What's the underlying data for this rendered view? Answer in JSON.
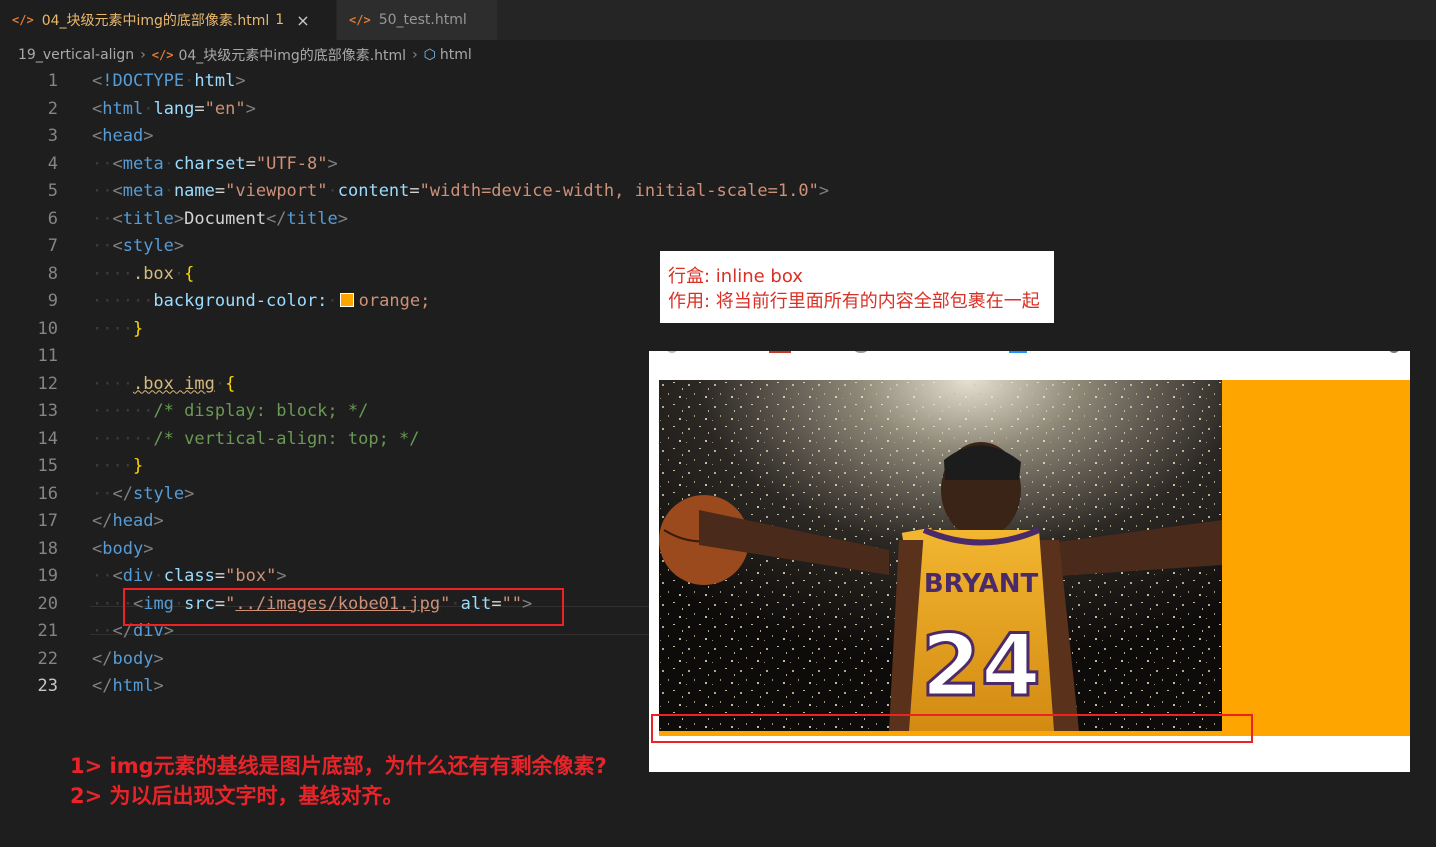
{
  "tabs": [
    {
      "icon": "</>",
      "label": "04_块级元素中img的底部像素.html",
      "badge": "1",
      "close": "×"
    },
    {
      "icon": "</>",
      "label": "50_test.html"
    }
  ],
  "breadcrumb": [
    "19_vertical-align",
    "04_块级元素中img的底部像素.html",
    "html"
  ],
  "code_lines": [
    {
      "n": "1"
    },
    {
      "n": "2"
    },
    {
      "n": "3"
    },
    {
      "n": "4"
    },
    {
      "n": "5"
    },
    {
      "n": "6"
    },
    {
      "n": "7"
    },
    {
      "n": "8"
    },
    {
      "n": "9"
    },
    {
      "n": "10"
    },
    {
      "n": "11"
    },
    {
      "n": "12"
    },
    {
      "n": "13"
    },
    {
      "n": "14"
    },
    {
      "n": "15"
    },
    {
      "n": "16"
    },
    {
      "n": "17"
    },
    {
      "n": "18"
    },
    {
      "n": "19"
    },
    {
      "n": "20"
    },
    {
      "n": "21"
    },
    {
      "n": "22"
    },
    {
      "n": "23"
    }
  ],
  "code": {
    "doctype": "!DOCTYPE",
    "html_kw": "html",
    "lang_attr": "lang",
    "lang_val": "\"en\"",
    "head": "head",
    "meta": "meta",
    "charset": "charset",
    "charset_val": "\"UTF-8\"",
    "name": "name",
    "name_val": "\"viewport\"",
    "content": "content",
    "content_val": "\"width=device-width, initial-scale=1.0\"",
    "title": "title",
    "title_text": "Document",
    "style": "style",
    "sel_box": ".box",
    "prop_bg": "background-color:",
    "val_orange": "orange;",
    "sel_box_img": ".box img",
    "comment1": "/* display: block; */",
    "comment2": "/* vertical-align: top; */",
    "body": "body",
    "div": "div",
    "class_attr": "class",
    "class_val": "\"box\"",
    "img": "img",
    "src_attr": "src",
    "src_val": "../images/kobe01.jpg",
    "alt_attr": "alt",
    "alt_val": "\"\""
  },
  "tooltip": {
    "line1": "行盒: inline box",
    "line2": "作用: 将当前行里面所有的内容全部包裹在一起"
  },
  "photo": {
    "jersey_name": "BRYANT",
    "jersey_number": "24"
  },
  "notes": [
    "1> img元素的基线是图片底部，为什么还有有剩余像素?",
    "2> 为以后出现文字时，基线对齐。"
  ],
  "colors": {
    "accent": "#e22222",
    "box_bg": "#ffa500",
    "editor_bg": "#1e1e1e"
  }
}
